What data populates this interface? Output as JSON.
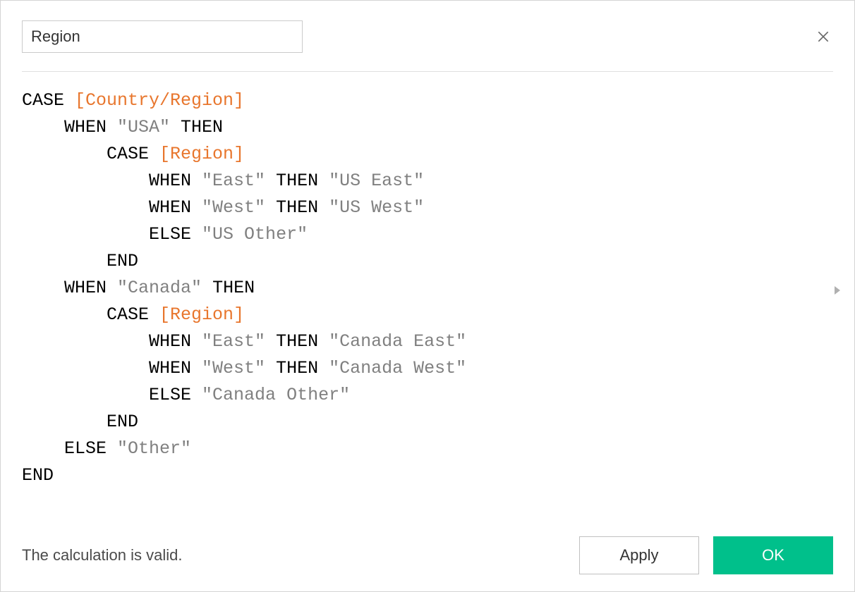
{
  "header": {
    "name_value": "Region"
  },
  "formula": {
    "tokens": [
      {
        "t": "kw",
        "v": "CASE "
      },
      {
        "t": "field",
        "v": "[Country/Region]"
      },
      {
        "t": "nl"
      },
      {
        "t": "sp",
        "n": 4
      },
      {
        "t": "kw",
        "v": "WHEN "
      },
      {
        "t": "str",
        "v": "\"USA\""
      },
      {
        "t": "kw",
        "v": " THEN"
      },
      {
        "t": "nl"
      },
      {
        "t": "sp",
        "n": 8
      },
      {
        "t": "kw",
        "v": "CASE "
      },
      {
        "t": "field",
        "v": "[Region]"
      },
      {
        "t": "nl"
      },
      {
        "t": "sp",
        "n": 12
      },
      {
        "t": "kw",
        "v": "WHEN "
      },
      {
        "t": "str",
        "v": "\"East\""
      },
      {
        "t": "kw",
        "v": " THEN "
      },
      {
        "t": "str",
        "v": "\"US East\""
      },
      {
        "t": "nl"
      },
      {
        "t": "sp",
        "n": 12
      },
      {
        "t": "kw",
        "v": "WHEN "
      },
      {
        "t": "str",
        "v": "\"West\""
      },
      {
        "t": "kw",
        "v": " THEN "
      },
      {
        "t": "str",
        "v": "\"US West\""
      },
      {
        "t": "nl"
      },
      {
        "t": "sp",
        "n": 12
      },
      {
        "t": "kw",
        "v": "ELSE "
      },
      {
        "t": "str",
        "v": "\"US Other\""
      },
      {
        "t": "nl"
      },
      {
        "t": "sp",
        "n": 8
      },
      {
        "t": "kw",
        "v": "END"
      },
      {
        "t": "nl"
      },
      {
        "t": "sp",
        "n": 4
      },
      {
        "t": "kw",
        "v": "WHEN "
      },
      {
        "t": "str",
        "v": "\"Canada\""
      },
      {
        "t": "kw",
        "v": " THEN"
      },
      {
        "t": "nl"
      },
      {
        "t": "sp",
        "n": 8
      },
      {
        "t": "kw",
        "v": "CASE "
      },
      {
        "t": "field",
        "v": "[Region]"
      },
      {
        "t": "nl"
      },
      {
        "t": "sp",
        "n": 12
      },
      {
        "t": "kw",
        "v": "WHEN "
      },
      {
        "t": "str",
        "v": "\"East\""
      },
      {
        "t": "kw",
        "v": " THEN "
      },
      {
        "t": "str",
        "v": "\"Canada East\""
      },
      {
        "t": "nl"
      },
      {
        "t": "sp",
        "n": 12
      },
      {
        "t": "kw",
        "v": "WHEN "
      },
      {
        "t": "str",
        "v": "\"West\""
      },
      {
        "t": "kw",
        "v": " THEN "
      },
      {
        "t": "str",
        "v": "\"Canada West\""
      },
      {
        "t": "nl"
      },
      {
        "t": "sp",
        "n": 12
      },
      {
        "t": "kw",
        "v": "ELSE "
      },
      {
        "t": "str",
        "v": "\"Canada Other\""
      },
      {
        "t": "nl"
      },
      {
        "t": "sp",
        "n": 8
      },
      {
        "t": "kw",
        "v": "END"
      },
      {
        "t": "nl"
      },
      {
        "t": "sp",
        "n": 4
      },
      {
        "t": "kw",
        "v": "ELSE "
      },
      {
        "t": "str",
        "v": "\"Other\""
      },
      {
        "t": "nl"
      },
      {
        "t": "kw",
        "v": "END"
      }
    ]
  },
  "footer": {
    "validation_msg": "The calculation is valid.",
    "apply_label": "Apply",
    "ok_label": "OK"
  }
}
